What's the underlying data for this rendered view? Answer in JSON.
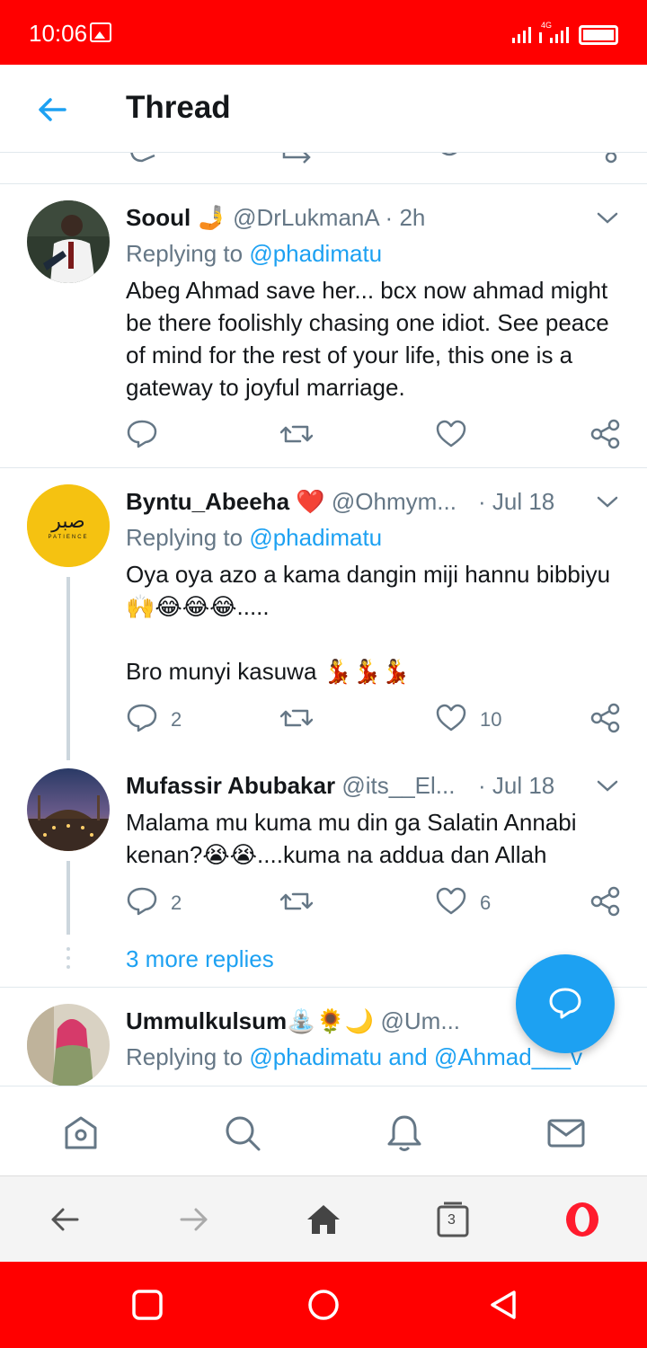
{
  "status_bar": {
    "time": "10:06",
    "network": "4G"
  },
  "header": {
    "title": "Thread"
  },
  "tweets": [
    {
      "name": "Sooul",
      "name_emoji": "🤳",
      "handle": "@DrLukmanA",
      "time": "2h",
      "reply_prefix": "Replying to ",
      "reply_mentions": "@phadimatu",
      "body": "Abeg Ahmad save her... bcx now ahmad might be there foolishly chasing one idiot. See peace of mind for the rest of your life, this one is a gateway to joyful marriage.",
      "replies": "",
      "retweets": "",
      "likes": ""
    },
    {
      "name": "Byntu_Abeeha",
      "name_emoji": "❤️",
      "handle": "@Ohmym...",
      "time": "Jul 18",
      "reply_prefix": "Replying to ",
      "reply_mentions": "@phadimatu",
      "body_line1": "Oya oya azo a kama dangin miji hannu bibbiyu 🙌😂😂😂.....",
      "body_line2": "Bro munyi kasuwa 💃💃💃",
      "avatar_arabic": "صبر",
      "avatar_text": "PATIENCE",
      "replies": "2",
      "retweets": "",
      "likes": "10"
    },
    {
      "name": "Mufassir Abubakar",
      "handle": "@its__El...",
      "time": "Jul 18",
      "body": "Malama mu kuma mu din ga Salatin Annabi kenan?😭😭....kuma na addua dan Allah",
      "replies": "2",
      "retweets": "",
      "likes": "6"
    },
    {
      "name": "Ummulkulsum",
      "name_emoji": "⛲🌻🌙",
      "handle": "@Um...",
      "reply_prefix": "Replying to ",
      "reply_mentions": "@phadimatu and @Ahmad___v"
    }
  ],
  "more_replies": "3 more replies",
  "tab_count": "3",
  "colors": {
    "status_red": "#ff0000",
    "twitter_blue": "#1da1f2",
    "gray": "#657786"
  }
}
